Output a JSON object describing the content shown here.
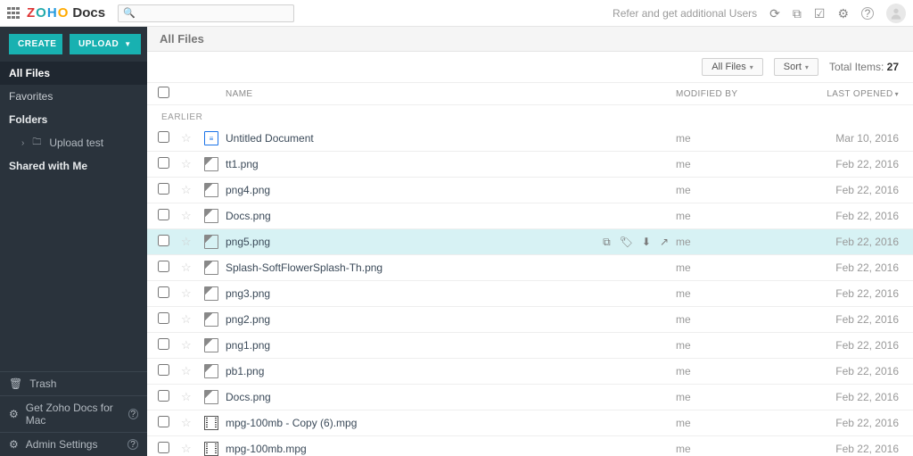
{
  "topbar": {
    "app_name_parts": [
      "Z",
      "O",
      "H",
      "O"
    ],
    "app_suffix": "Docs",
    "search_placeholder": "",
    "refer_text": "Refer and get additional Users"
  },
  "sidebar": {
    "create_label": "CREATE",
    "upload_label": "UPLOAD",
    "items": [
      {
        "label": "All Files",
        "active": true
      },
      {
        "label": "Favorites"
      }
    ],
    "folders_label": "Folders",
    "folders": [
      {
        "label": "Upload test"
      }
    ],
    "shared_label": "Shared with Me",
    "bottom": [
      {
        "icon": "trash",
        "label": "Trash"
      },
      {
        "icon": "gear",
        "label": "Get Zoho Docs for Mac",
        "help": true
      },
      {
        "icon": "gear",
        "label": "Admin Settings",
        "help": true
      }
    ]
  },
  "main": {
    "title": "All Files",
    "filter_label": "All Files",
    "sort_label": "Sort",
    "total_label": "Total Items:",
    "total_value": "27",
    "columns": {
      "name": "NAME",
      "modified": "MODIFIED BY",
      "last": "LAST OPENED"
    },
    "group_label": "EARLIER",
    "rows": [
      {
        "icon": "doc",
        "name": "Untitled Document",
        "modified": "me",
        "last": "Mar 10, 2016"
      },
      {
        "icon": "img",
        "name": "tt1.png",
        "modified": "me",
        "last": "Feb 22, 2016"
      },
      {
        "icon": "img",
        "name": "png4.png",
        "modified": "me",
        "last": "Feb 22, 2016"
      },
      {
        "icon": "img",
        "name": "Docs.png",
        "modified": "me",
        "last": "Feb 22, 2016"
      },
      {
        "icon": "img",
        "name": "png5.png",
        "modified": "me",
        "last": "Feb 22, 2016",
        "selected": true
      },
      {
        "icon": "img",
        "name": "Splash-SoftFlowerSplash-Th.png",
        "modified": "me",
        "last": "Feb 22, 2016"
      },
      {
        "icon": "img",
        "name": "png3.png",
        "modified": "me",
        "last": "Feb 22, 2016"
      },
      {
        "icon": "img",
        "name": "png2.png",
        "modified": "me",
        "last": "Feb 22, 2016"
      },
      {
        "icon": "img",
        "name": "png1.png",
        "modified": "me",
        "last": "Feb 22, 2016"
      },
      {
        "icon": "img",
        "name": "pb1.png",
        "modified": "me",
        "last": "Feb 22, 2016"
      },
      {
        "icon": "img",
        "name": "Docs.png",
        "modified": "me",
        "last": "Feb 22, 2016"
      },
      {
        "icon": "vid",
        "name": "mpg-100mb - Copy (6).mpg",
        "modified": "me",
        "last": "Feb 22, 2016"
      },
      {
        "icon": "vid",
        "name": "mpg-100mb.mpg",
        "modified": "me",
        "last": "Feb 22, 2016"
      }
    ],
    "row_actions": [
      "preview",
      "tag",
      "download",
      "share"
    ]
  }
}
